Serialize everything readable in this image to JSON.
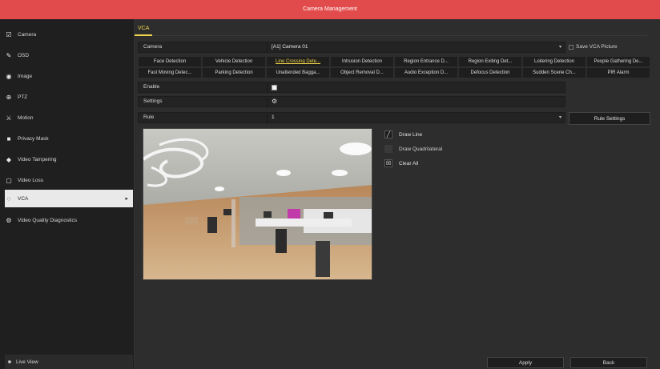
{
  "window": {
    "title": "Camera Management"
  },
  "sidebar": {
    "items": [
      {
        "label": "Camera",
        "icon": "camera-icon",
        "glyph": "☑"
      },
      {
        "label": "OSD",
        "icon": "osd-icon",
        "glyph": "✎"
      },
      {
        "label": "Image",
        "icon": "image-icon",
        "glyph": "◉"
      },
      {
        "label": "PTZ",
        "icon": "ptz-icon",
        "glyph": "⊕"
      },
      {
        "label": "Motion",
        "icon": "motion-icon",
        "glyph": "⚔"
      },
      {
        "label": "Privacy Mask",
        "icon": "privacy-mask-icon",
        "glyph": "■"
      },
      {
        "label": "Video Tampering",
        "icon": "video-tampering-icon",
        "glyph": "◆"
      },
      {
        "label": "Video Loss",
        "icon": "video-loss-icon",
        "glyph": "▢"
      },
      {
        "label": "VCA",
        "icon": "vca-icon",
        "glyph": "◌",
        "active": true
      },
      {
        "label": "Video Quality Diagnostics",
        "icon": "video-quality-icon",
        "glyph": "⚙"
      }
    ],
    "live_view": {
      "label": "Live View",
      "icon": "live-view-icon",
      "glyph": "■"
    }
  },
  "main": {
    "tab": "VCA",
    "camera_label": "Camera",
    "camera_value": "[A1] Camera 01",
    "save_vca_picture": "Save VCA Picture",
    "detections": [
      {
        "label": "Face Detection"
      },
      {
        "label": "Vehicle Detection"
      },
      {
        "label": "Line Crossing Dete...",
        "active": true
      },
      {
        "label": "Intrusion Detection"
      },
      {
        "label": "Region Entrance D..."
      },
      {
        "label": "Region Exiting Det..."
      },
      {
        "label": "Loitering Detection"
      },
      {
        "label": "People Gathering De..."
      },
      {
        "label": "Fast Moving Detec..."
      },
      {
        "label": "Parking Detection"
      },
      {
        "label": "Unattended Bagga..."
      },
      {
        "label": "Object Removal D..."
      },
      {
        "label": "Audio Exception D..."
      },
      {
        "label": "Defocus Detection"
      },
      {
        "label": "Sudden Scene Ch..."
      },
      {
        "label": "PIR Alarm"
      }
    ],
    "enable_label": "Enable",
    "enable_checked": true,
    "settings_label": "Settings",
    "rule_label": "Rule",
    "rule_value": "1",
    "rule_settings_button": "Rule Settings",
    "tools": [
      {
        "label": "Draw Line",
        "icon": "draw-line-icon",
        "glyph": "╱",
        "enabled": true
      },
      {
        "label": "Draw Quadrilateral",
        "icon": "draw-quadrilateral-icon",
        "glyph": "",
        "enabled": false
      },
      {
        "label": "Clear All",
        "icon": "clear-all-icon",
        "glyph": "☒",
        "enabled": true
      }
    ],
    "apply_button": "Apply",
    "back_button": "Back"
  }
}
